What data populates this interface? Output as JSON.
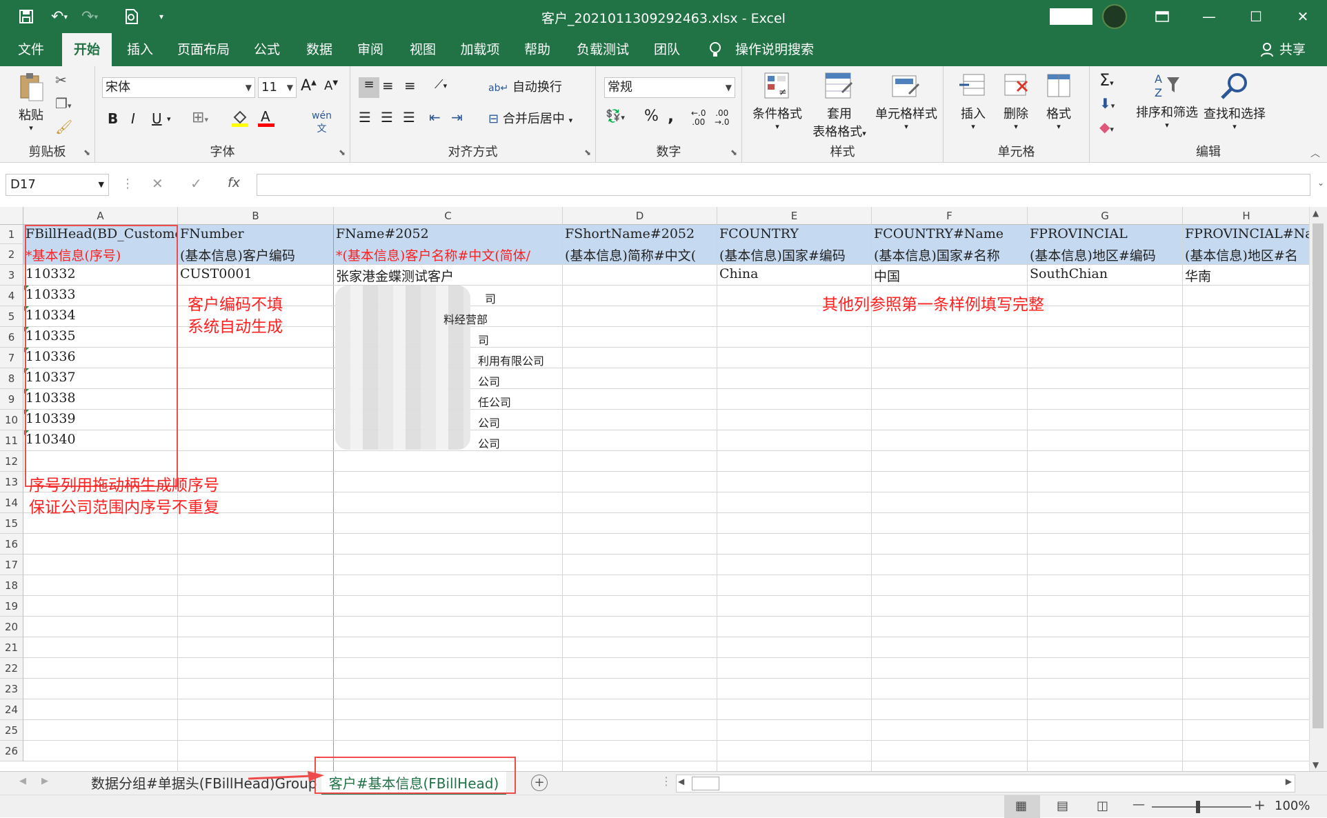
{
  "window": {
    "title": "客户_2021011309292463.xlsx  -  Excel",
    "minimize_icon": "minimize-icon",
    "restore_icon": "restore-icon",
    "close_icon": "close-icon"
  },
  "quick_access": [
    "save-icon",
    "undo-icon",
    "redo-icon",
    "print-preview-icon",
    "customize-icon"
  ],
  "ribbon_tabs": [
    "文件",
    "开始",
    "插入",
    "页面布局",
    "公式",
    "数据",
    "审阅",
    "视图",
    "加载项",
    "帮助",
    "负载测试",
    "团队"
  ],
  "tell_me": "操作说明搜索",
  "share": "共享",
  "ribbon": {
    "clipboard": {
      "paste": "粘贴",
      "label": "剪贴板"
    },
    "font": {
      "name": "宋体",
      "size": "11",
      "label": "字体",
      "bold": "B",
      "italic": "I",
      "underline": "U"
    },
    "alignment": {
      "wrap": "自动换行",
      "merge": "合并后居中",
      "label": "对齐方式"
    },
    "number": {
      "format": "常规",
      "percent": "%",
      "comma": ",",
      "label": "数字"
    },
    "styles": {
      "conditional": "条件格式",
      "table_line1": "套用",
      "table_line2": "表格格式",
      "cell_styles": "单元格样式",
      "label": "样式"
    },
    "cells": {
      "insert": "插入",
      "delete": "删除",
      "format": "格式",
      "label": "单元格"
    },
    "editing": {
      "sort": "排序和筛选",
      "find": "查找和选择",
      "label": "编辑"
    }
  },
  "formula_bar": {
    "name_box": "D17",
    "formula": "",
    "fx": "fx"
  },
  "columns": [
    "A",
    "B",
    "C",
    "D",
    "E",
    "F",
    "G",
    "H"
  ],
  "rows": [
    "1",
    "2",
    "3",
    "4",
    "5",
    "6",
    "7",
    "8",
    "9",
    "10",
    "11",
    "12",
    "13",
    "14",
    "15",
    "16",
    "17",
    "18",
    "19",
    "20",
    "21",
    "22",
    "23",
    "24",
    "25",
    "26"
  ],
  "header_row1": [
    "FBillHead(BD_Custome",
    "FNumber",
    "FName#2052",
    "FShortName#2052",
    "FCOUNTRY",
    "FCOUNTRY#Name",
    "FPROVINCIAL",
    "FPROVINCIAL#Name"
  ],
  "header_row2": [
    "*基本信息(序号)",
    "(基本信息)客户编码",
    "*(基本信息)客户名称#中文(简体/",
    "(基本信息)简称#中文(",
    "(基本信息)国家#编码",
    "(基本信息)国家#名称",
    "(基本信息)地区#编码",
    "(基本信息)地区#名"
  ],
  "data_row3": [
    "110332",
    "CUST0001",
    "张家港金蝶测试客户",
    "",
    "China",
    "中国",
    "SouthChian",
    "华南"
  ],
  "seq_numbers": [
    "110333",
    "110334",
    "110335",
    "110336",
    "110337",
    "110338",
    "110339",
    "110340"
  ],
  "blurred_fragments": [
    "司",
    "料经营部",
    "司",
    "利用有限公司",
    "公司",
    "任公司",
    "公司",
    "公司"
  ],
  "notes": {
    "code_line1": "客户编码不填",
    "code_line2": "系统自动生成",
    "other_cols": "其他列参照第一条样例填写完整",
    "seq_line1": "序号列用拖动柄生成顺序号",
    "seq_line2": "保证公司范围内序号不重复"
  },
  "sheets": [
    "数据分组#单据头(FBillHead)Group",
    "客户#基本信息(FBillHead)"
  ],
  "status": {
    "zoom": "100%"
  }
}
